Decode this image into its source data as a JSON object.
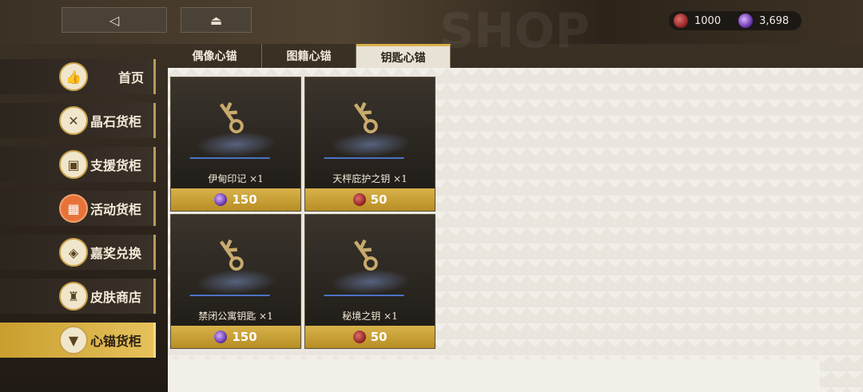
{
  "currency": {
    "red": {
      "icon": "red-gem-icon",
      "amount": "1000"
    },
    "purple": {
      "icon": "purple-crystal-icon",
      "amount": "3,698"
    }
  },
  "watermark": "SHOP",
  "tabs": [
    "偶像心锚",
    "图籍心锚",
    "钥匙心锚"
  ],
  "sidebar": [
    {
      "label": "首页",
      "icon": "thumbs-up-icon"
    },
    {
      "label": "晶石货柜",
      "icon": "crossed-swords-icon"
    },
    {
      "label": "支援货柜",
      "icon": "support-crate-icon"
    },
    {
      "label": "活动货柜",
      "icon": "event-crate-icon"
    },
    {
      "label": "嘉奖兑换",
      "icon": "badge-icon"
    },
    {
      "label": "皮肤商店",
      "icon": "outfit-icon"
    },
    {
      "label": "心锚货柜",
      "icon": "heart-anchor-icon"
    }
  ],
  "items": [
    {
      "name": "伊甸印记 ×1",
      "price": "150",
      "currency": "purple"
    },
    {
      "name": "天枰庇护之钥 ×1",
      "price": "50",
      "currency": "red"
    },
    {
      "name": "禁闭公寓钥匙 ×1",
      "price": "150",
      "currency": "purple"
    },
    {
      "name": "秘境之钥 ×1",
      "price": "50",
      "currency": "red"
    }
  ],
  "colors": {
    "accent": "#d9b04a",
    "active_side": "#c99e2e"
  }
}
